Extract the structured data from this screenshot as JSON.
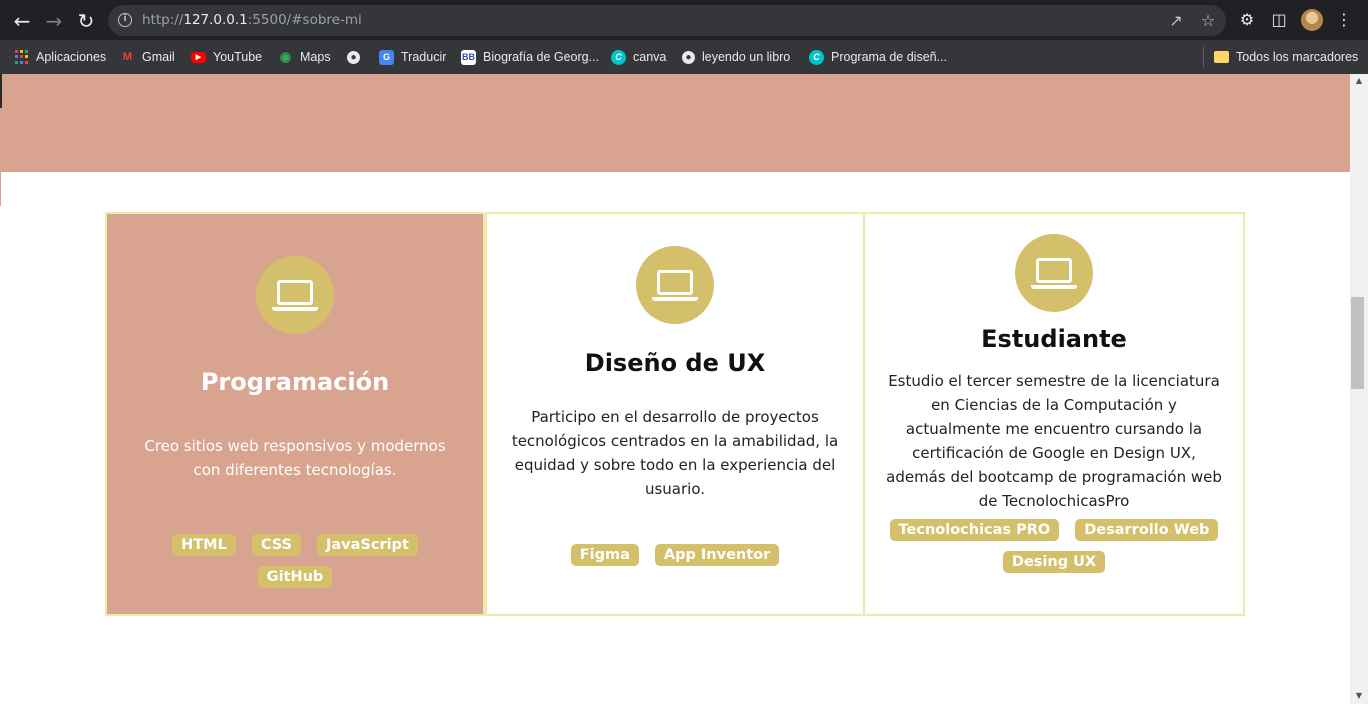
{
  "browser": {
    "url_prefix": "http://",
    "url_host": "127.0.0.1",
    "url_rest": ":5500/#sobre-mi",
    "back_icon": "arrow-left-icon",
    "forward_icon": "arrow-right-icon",
    "reload_icon": "reload-icon"
  },
  "bookmarks": [
    {
      "label": "Aplicaciones",
      "icon": "apps-grid-icon",
      "color": "#ea4335"
    },
    {
      "label": "Gmail",
      "icon": "gmail-icon",
      "color": "#ea4335"
    },
    {
      "label": "YouTube",
      "icon": "youtube-icon",
      "color": "#ff0000"
    },
    {
      "label": "Maps",
      "icon": "maps-pin-icon",
      "color": "#34a853"
    },
    {
      "label": "",
      "icon": "globe-icon",
      "color": "#e8eaed"
    },
    {
      "label": "Traducir",
      "icon": "translate-icon",
      "color": "#4285f4"
    },
    {
      "label": "Biografía de Georg...",
      "icon": "bb-icon",
      "color": "#3c4aa8"
    },
    {
      "label": "canva",
      "icon": "canva-icon",
      "color": "#00c4cc"
    },
    {
      "label": "leyendo un libro",
      "icon": "globe-icon",
      "color": "#e8eaed"
    },
    {
      "label": "Programa de diseñ...",
      "icon": "canva-icon",
      "color": "#00c4cc"
    }
  ],
  "all_bookmarks_label": "Todos los marcadores",
  "colors": {
    "hero": "#d8a48f",
    "accent": "#d4bf6a",
    "card_border": "#eeeba8"
  },
  "cards": [
    {
      "title": "Programación",
      "text": "Creo sitios web responsivos y modernos con diferentes tecnologías.",
      "icon": "laptop-icon",
      "tags": [
        "HTML",
        "CSS",
        "JavaScript",
        "GitHub"
      ]
    },
    {
      "title": "Diseño de UX",
      "text": "Participo en el desarrollo de proyectos tecnológicos centrados en la amabilidad, la equidad y sobre todo en la experiencia del usuario.",
      "icon": "laptop-icon",
      "tags": [
        "Figma",
        "App Inventor"
      ]
    },
    {
      "title": "Estudiante",
      "text": "Estudio el tercer semestre de la licenciatura en Ciencias de la Computación y actualmente me encuentro cursando la certificación de Google en Design UX, además del bootcamp de programación web de TecnolochicasPro",
      "icon": "laptop-icon",
      "tags": [
        "Tecnolochicas PRO",
        "Desarrollo Web",
        "Desing UX"
      ]
    }
  ]
}
